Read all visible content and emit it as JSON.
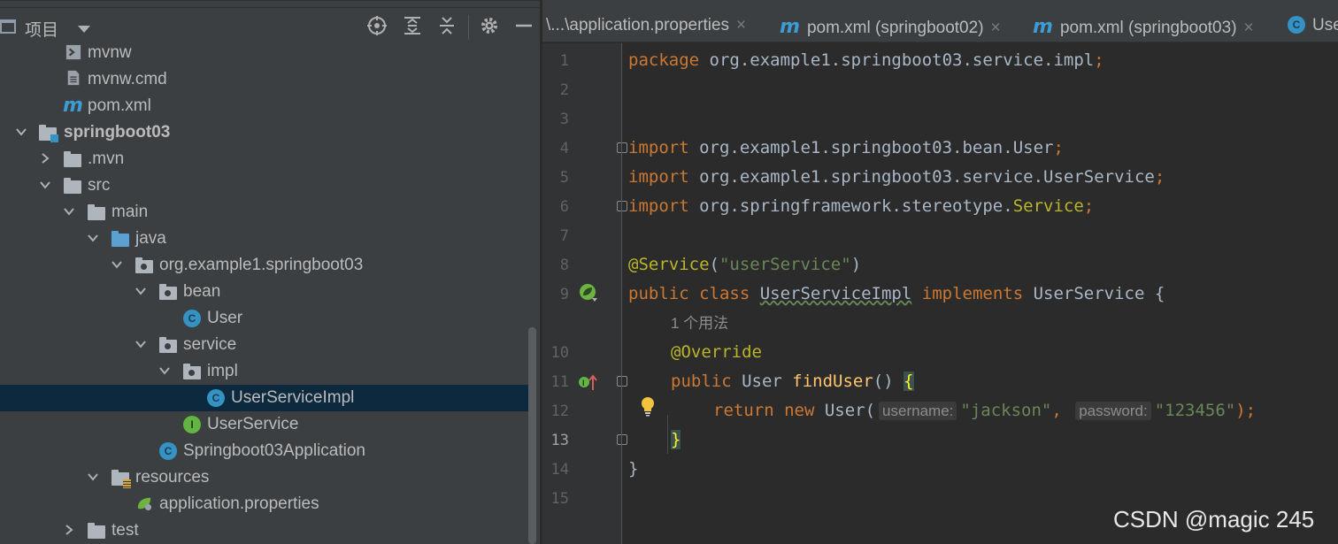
{
  "panel": {
    "title": "项目",
    "toolbar_icons": [
      "locate-icon",
      "expand-all-icon",
      "collapse-all-icon",
      "gear-icon",
      "hide-icon"
    ]
  },
  "tree": [
    {
      "label": "mvnw",
      "icon": "terminal-file-icon"
    },
    {
      "label": "mvnw.cmd",
      "icon": "text-file-icon"
    },
    {
      "label": "pom.xml",
      "icon": "maven-icon"
    },
    {
      "label": "springboot03",
      "icon": "module-folder-icon",
      "expanded": true,
      "bold": true
    },
    {
      "label": ".mvn",
      "icon": "folder-icon",
      "expanded": false
    },
    {
      "label": "src",
      "icon": "folder-icon",
      "expanded": true
    },
    {
      "label": "main",
      "icon": "folder-icon",
      "expanded": true
    },
    {
      "label": "java",
      "icon": "source-folder-icon",
      "expanded": true
    },
    {
      "label": "org.example1.springboot03",
      "icon": "package-icon",
      "expanded": true
    },
    {
      "label": "bean",
      "icon": "package-icon",
      "expanded": true
    },
    {
      "label": "User",
      "icon": "class-icon"
    },
    {
      "label": "service",
      "icon": "package-icon",
      "expanded": true
    },
    {
      "label": "impl",
      "icon": "package-icon",
      "expanded": true
    },
    {
      "label": "UserServiceImpl",
      "icon": "class-icon",
      "selected": true
    },
    {
      "label": "UserService",
      "icon": "interface-icon"
    },
    {
      "label": "Springboot03Application",
      "icon": "spring-boot-class-icon"
    },
    {
      "label": "resources",
      "icon": "resources-folder-icon",
      "expanded": true
    },
    {
      "label": "application.properties",
      "icon": "spring-properties-icon"
    },
    {
      "label": "test",
      "icon": "folder-icon",
      "expanded": false
    }
  ],
  "tabs": [
    {
      "label": "\\...\\application.properties",
      "close": "×"
    },
    {
      "label": "pom.xml (springboot02)",
      "close": "×",
      "icon": "maven-icon"
    },
    {
      "label": "pom.xml (springboot03)",
      "close": "×",
      "icon": "maven-icon"
    },
    {
      "label": "Use",
      "icon": "class-icon"
    }
  ],
  "editor": {
    "line_numbers": [
      "1",
      "2",
      "3",
      "4",
      "5",
      "6",
      "7",
      "8",
      "9",
      "",
      "10",
      "11",
      "12",
      "13",
      "14",
      "15"
    ],
    "current_line": "13",
    "code": {
      "l1_kw": "package",
      "l1_rest": " org.example1.springboot03.service.impl",
      "l1_semi": ";",
      "l4_kw": "import",
      "l4_rest": " org.example1.springboot03.bean.User",
      "l5_kw": "import",
      "l5_rest": " org.example1.springboot03.service.UserService",
      "l6_kw": "import",
      "l6_rest": " org.springframework.stereotype.",
      "l6_svc": "Service",
      "semi": ";",
      "l8_ann": "@Service",
      "l8_open": "(",
      "l8_str": "\"userService\"",
      "l8_close": ")",
      "l9_kw1": "public class ",
      "l9_cls": "UserServiceImpl",
      "l9_kw2": " implements ",
      "l9_iface": "UserService {",
      "usages": "1 个用法",
      "l10_ann": "@Override",
      "l11_kw": "public ",
      "l11_type": "User ",
      "l11_fn": "findUser",
      "l11_parens": "() ",
      "l11_brace": "{",
      "l12_kw": "return new ",
      "l12_cls": "User(",
      "l12_hint1": "username:",
      "l12_str1": "\"jackson\"",
      "l12_comma": ", ",
      "l12_hint2": "password:",
      "l12_str2": "\"123456\"",
      "l12_end": ");",
      "l13_brace": "}",
      "l14_brace": "}"
    }
  },
  "watermark": "CSDN @magic 245",
  "colors": {
    "keyword": "#cc7832",
    "string": "#6a8759",
    "annotation": "#bbb529",
    "function": "#ffc66d",
    "selection": "#0d293e"
  }
}
